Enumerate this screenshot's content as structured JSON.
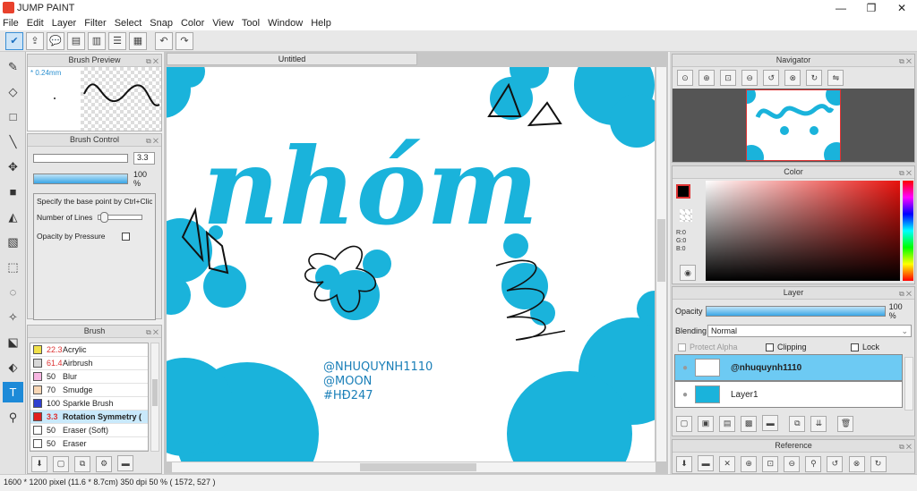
{
  "app": {
    "title": "JUMP PAINT"
  },
  "menu": [
    "File",
    "Edit",
    "Layer",
    "Filter",
    "Select",
    "Snap",
    "Color",
    "View",
    "Tool",
    "Window",
    "Help"
  ],
  "brush_preview": {
    "title": "Brush Preview",
    "size_label": "* 0.24mm"
  },
  "brush_control": {
    "title": "Brush Control",
    "size_value": "3.3",
    "opacity_value": "100 %",
    "hint": "Specify the base point by Ctrl+Click (",
    "lines_label": "Number of Lines",
    "pressure_label": "Opacity by Pressure"
  },
  "brush_list": {
    "title": "Brush",
    "items": [
      {
        "size": "22.3",
        "name": "Acrylic",
        "color": "#f1e14a"
      },
      {
        "size": "61.4",
        "name": "Airbrush",
        "color": "#d8d8d8"
      },
      {
        "size": "50",
        "name": "Blur",
        "color": "#f7b6e2"
      },
      {
        "size": "70",
        "name": "Smudge",
        "color": "#f9d7b5"
      },
      {
        "size": "100",
        "name": "Sparkle Brush",
        "color": "#3040d0"
      },
      {
        "size": "3.3",
        "name": "Rotation Symmetry (",
        "color": "#e02020"
      },
      {
        "size": "50",
        "name": "Eraser (Soft)",
        "color": "#ffffff"
      },
      {
        "size": "50",
        "name": "Eraser",
        "color": "#ffffff"
      }
    ]
  },
  "canvas": {
    "tab": "Untitled",
    "word": "nhóm",
    "text_lines": [
      "@NHUQUYNH1110",
      "@MOON",
      "#HĐ247"
    ]
  },
  "navigator": {
    "title": "Navigator"
  },
  "color_panel": {
    "title": "Color",
    "r": "R:0",
    "g": "G:0",
    "b": "B:0"
  },
  "layer_panel": {
    "title": "Layer",
    "opacity_label": "Opacity",
    "opacity_value": "100 %",
    "blending_label": "Blending",
    "blending_value": "Normal",
    "protect_alpha": "Protect Alpha",
    "clipping": "Clipping",
    "lock": "Lock",
    "layers": [
      "@nhuquynh1110",
      "Layer1"
    ]
  },
  "reference": {
    "title": "Reference"
  },
  "status": {
    "text": "1600 * 1200 pixel   (11.6 * 8.7cm)  350 dpi   50 %   ( 1572, 527 )"
  },
  "colors": {
    "accent": "#1aaed6",
    "select": "#6dcaf3",
    "tool_active": "#1d8ad8"
  }
}
